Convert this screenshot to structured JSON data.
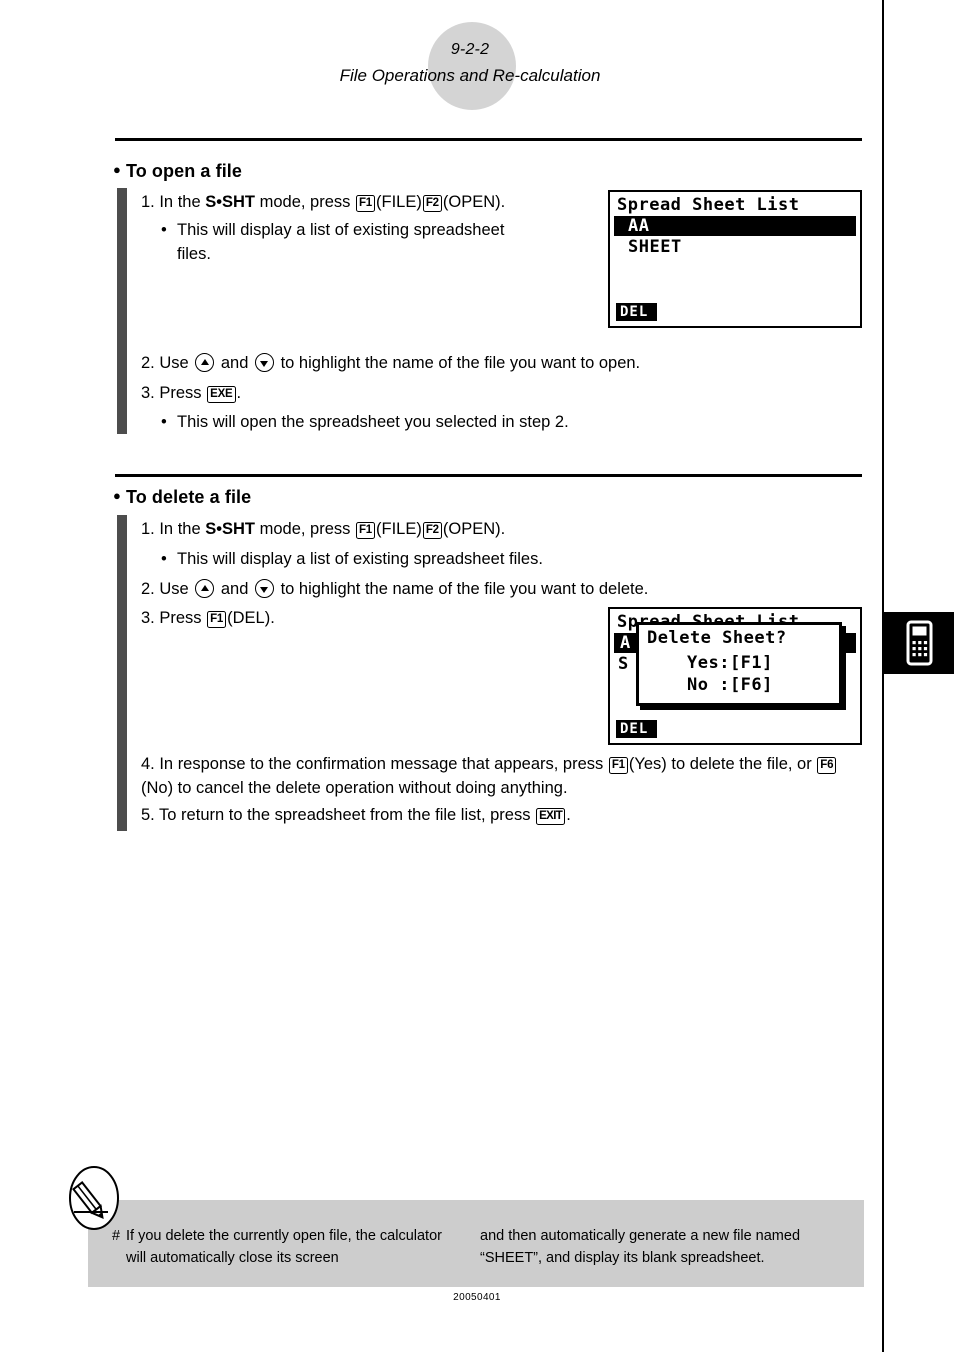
{
  "header": {
    "page_number": "9-2-2",
    "title": "File Operations and Re-calculation"
  },
  "sections": [
    {
      "heading": "To open a file",
      "steps": {
        "s1_pre": "1. In the ",
        "s1_mode": "S•SHT",
        "s1_mid": " mode, press ",
        "s1_key1": "F1",
        "s1_lbl1": "(FILE)",
        "s1_key2": "F2",
        "s1_lbl2": "(OPEN).",
        "s1_sub": "This will display a list of existing spreadsheet files.",
        "s2_pre": "2. Use ",
        "s2_mid": " and ",
        "s2_post": " to highlight the name of the file you want to open.",
        "s3_pre": "3. Press ",
        "s3_key": "EXE",
        "s3_post": ".",
        "s3_sub": "This will open the spreadsheet you selected in step 2."
      }
    },
    {
      "heading": "To delete a file",
      "steps": {
        "s1_pre": "1. In the ",
        "s1_mode": "S•SHT",
        "s1_mid": " mode, press ",
        "s1_key1": "F1",
        "s1_lbl1": "(FILE)",
        "s1_key2": "F2",
        "s1_lbl2": "(OPEN).",
        "s1_sub": "This will display a list of existing spreadsheet files.",
        "s2_pre": "2. Use ",
        "s2_mid": " and ",
        "s2_post": " to highlight the name of the file you want to delete.",
        "s3_pre": "3. Press ",
        "s3_key": "F1",
        "s3_post": "(DEL).",
        "s4_pre": "4. In response to the confirmation message that appears, press ",
        "s4_key1": "F1",
        "s4_mid": "(Yes) to delete the file, or ",
        "s4_key2": "F6",
        "s4_post": "(No) to cancel the delete operation without doing anything.",
        "s5_pre": "5. To return to the spreadsheet from the file list, press ",
        "s5_key": "EXIT",
        "s5_post": "."
      }
    }
  ],
  "lcd_open": {
    "title": "Spread Sheet List",
    "rows": [
      "AA",
      "SHEET"
    ],
    "selected_index": 0,
    "fkey": "DEL"
  },
  "lcd_delete": {
    "title_partial": "Spread Sheet List",
    "bg_row_1": "A",
    "bg_row_2": "S",
    "dialog_question": "Delete Sheet?",
    "dialog_yes": "Yes:[F1]",
    "dialog_no": "No :[F6]",
    "fkey": "DEL"
  },
  "footnote": {
    "marker": "#",
    "column_1": "If you delete the currently open file, the calculator will automatically close its screen",
    "column_2": "and then automatically generate a new file named “SHEET”, and display its blank spreadsheet."
  },
  "doc_code": "20050401",
  "colors": {
    "step_bar": "#4d4d4d",
    "header_circle": "#d4d4d4",
    "note_band": "#cdcdcd",
    "ink": "#000000"
  },
  "icons": {
    "side_tab": "calculator-icon",
    "note": "pencil-note-icon",
    "arrow_up": "arrow-up-key-icon",
    "arrow_down": "arrow-down-key-icon"
  }
}
